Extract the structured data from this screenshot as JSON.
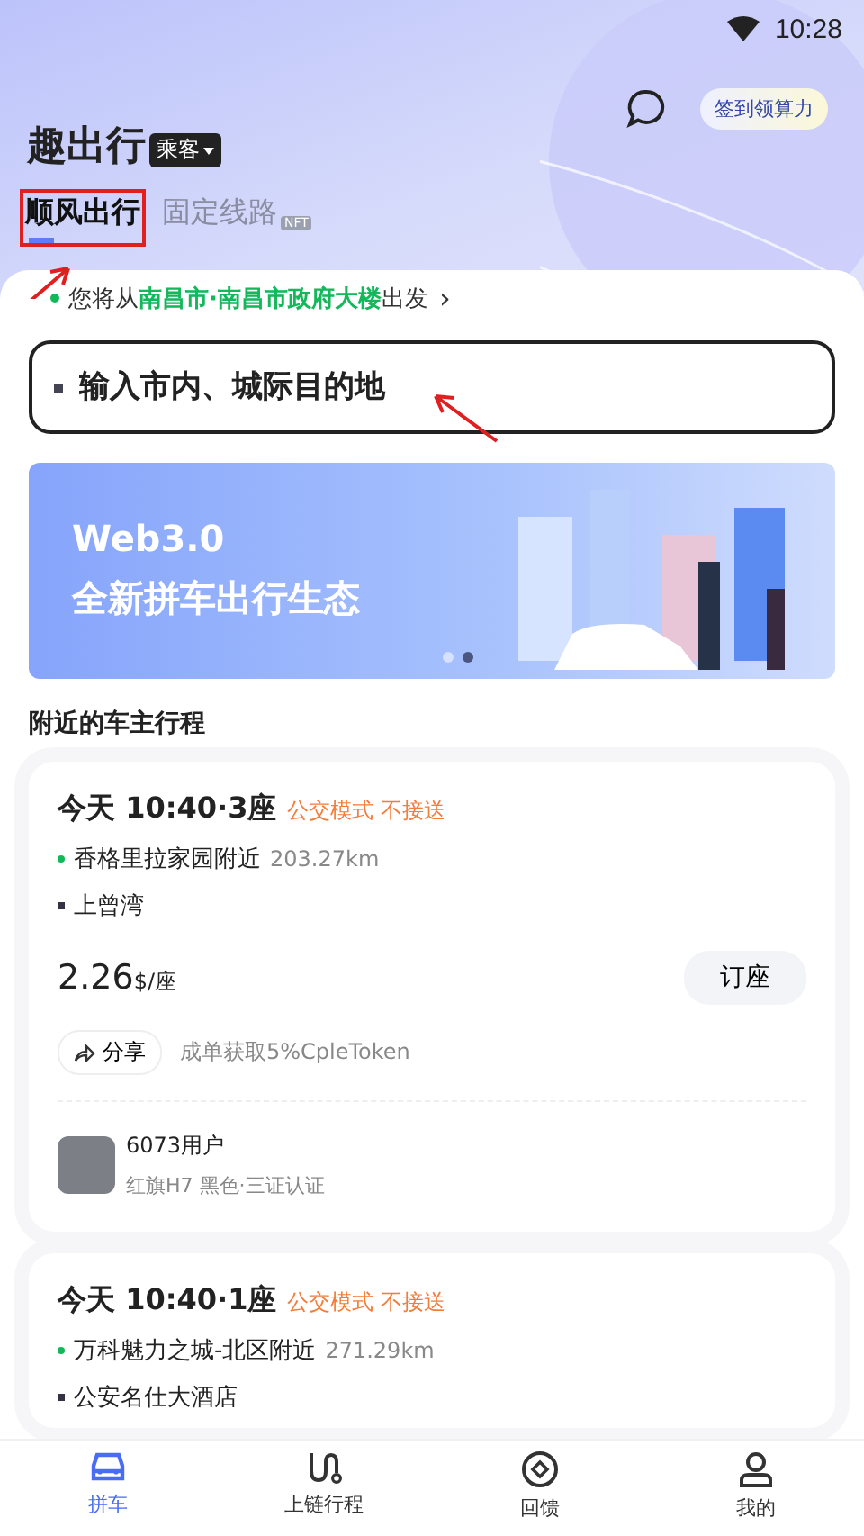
{
  "status_bar": {
    "time": "10:28"
  },
  "header": {
    "title": "趣出行",
    "role": "乘客",
    "checkin_button": "签到领算力"
  },
  "tabs": [
    {
      "label": "顺风出行",
      "selected": true,
      "highlighted": true
    },
    {
      "label": "固定线路",
      "selected": false,
      "highlighted": false,
      "badge": "NFT"
    }
  ],
  "origin": {
    "prefix": "您将从",
    "place": "南昌市·南昌市政府大楼",
    "suffix": "出发",
    "chevron": "›"
  },
  "destination": {
    "placeholder": "输入市内、城际目的地"
  },
  "banner": {
    "title": "Web3.0",
    "subtitle": "全新拼车出行生态",
    "dots": [
      {
        "selected": false
      },
      {
        "selected": true
      }
    ]
  },
  "section_title": "附近的车主行程",
  "trips": [
    {
      "time_seats": "今天 10:40·3座",
      "mode": "公交模式 不接送",
      "from": "香格里拉家园附近",
      "distance": "203.27km",
      "to": "上曾湾",
      "price": "2.26",
      "unit": "$/座",
      "book_button": "订座",
      "share_button": "分享",
      "reward": "成单获取5%CpleToken",
      "driver_name": "6073用户",
      "car": "红旗H7 黑色·三证认证"
    },
    {
      "time_seats": "今天 10:40·1座",
      "mode": "公交模式 不接送",
      "from": "万科魅力之城-北区附近",
      "distance": "271.29km",
      "to": "公安名仕大酒店"
    }
  ],
  "bottom_nav": [
    {
      "label": "拼车",
      "kind": "car",
      "selected": true
    },
    {
      "label": "上链行程",
      "kind": "route",
      "selected": false
    },
    {
      "label": "回馈",
      "kind": "feedback",
      "selected": false
    },
    {
      "label": "我的",
      "kind": "user",
      "selected": false
    }
  ]
}
